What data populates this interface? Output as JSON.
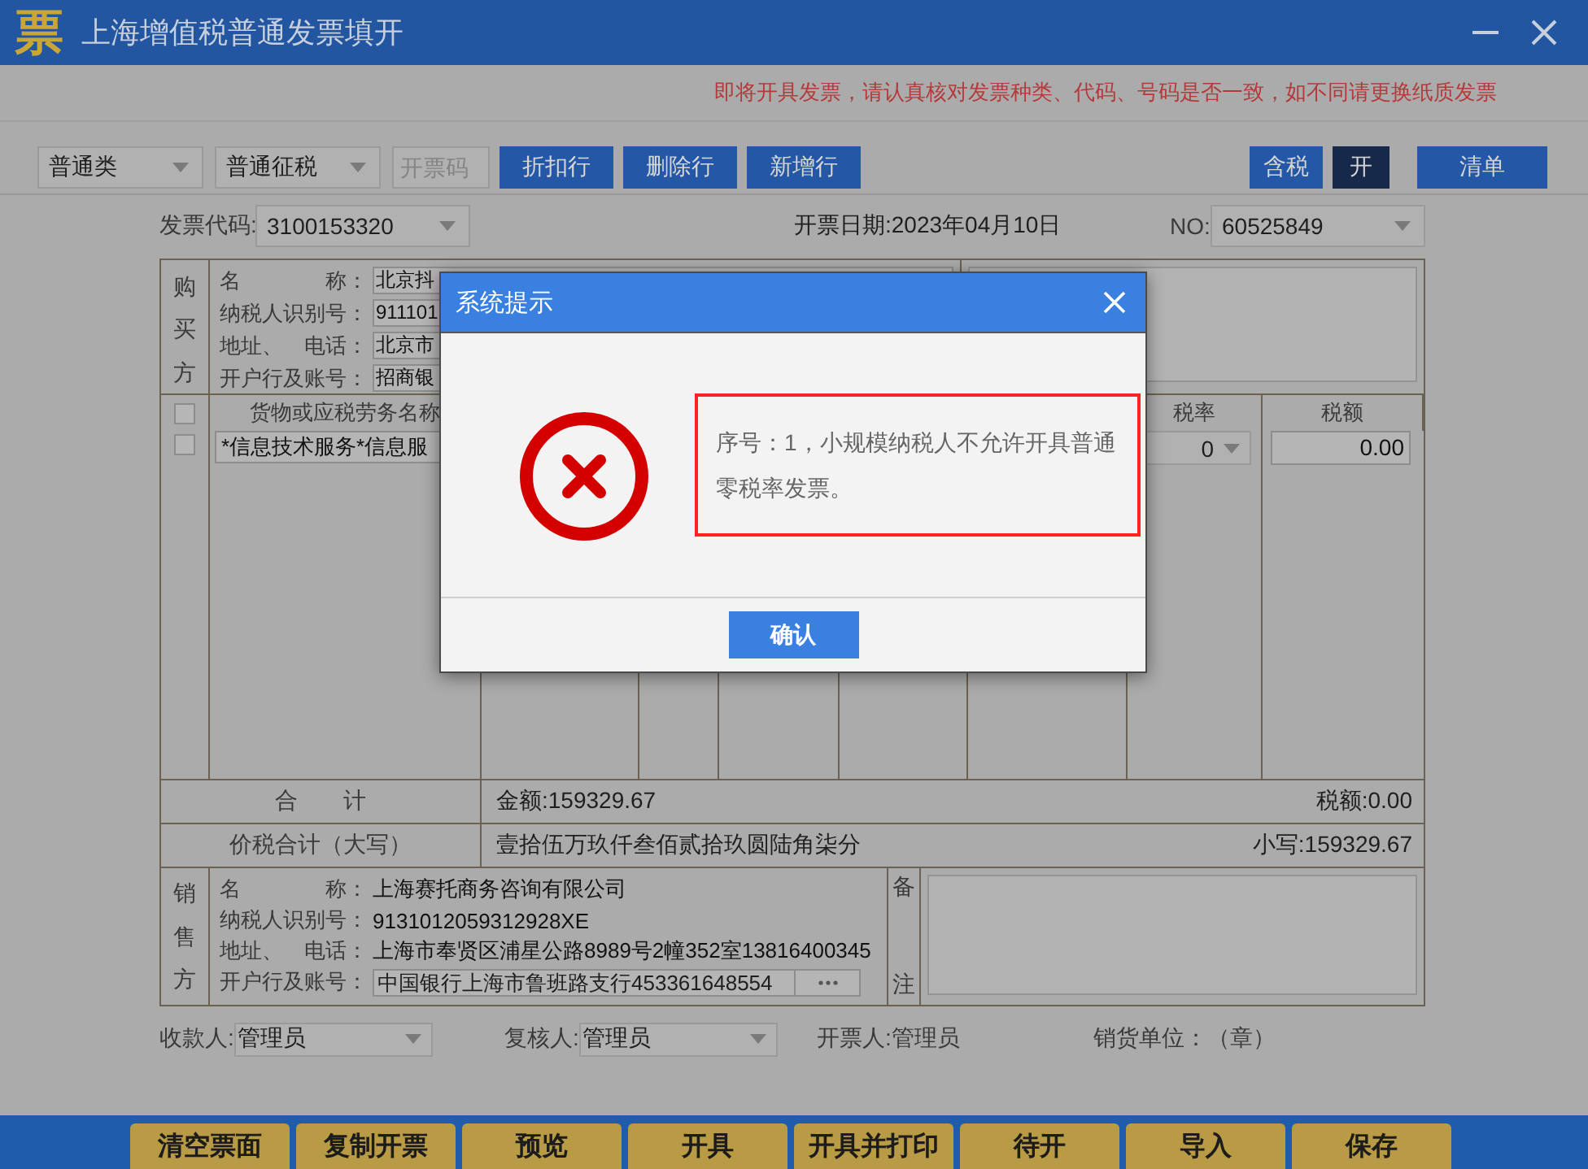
{
  "window": {
    "logo": "票",
    "title": "上海增值税普通发票填开"
  },
  "notice": "即将开具发票，请认真核对发票种类、代码、号码是否一致，如不同请更换纸质发票",
  "toolbar": {
    "selects": [
      {
        "value": "普通类"
      },
      {
        "value": "普通征税"
      }
    ],
    "code_field": {
      "placeholder": "开票码"
    },
    "buttons": [
      "折扣行",
      "删除行",
      "新增行"
    ],
    "tax_toggle": [
      {
        "label": "含税",
        "selected": false
      },
      {
        "label": "开",
        "selected": true
      }
    ],
    "list_button": "清单"
  },
  "header": {
    "code_label": "发票代码:",
    "code": "3100153320",
    "date": "开票日期:2023年04月10日",
    "no_label": "NO:",
    "no": "60525849"
  },
  "buyer": {
    "side_label": "购买方",
    "fields": [
      {
        "label": "名　　　　称：",
        "value": "北京抖"
      },
      {
        "label": "纳税人识别号：",
        "value": "911101"
      },
      {
        "label": "地址、　电话：",
        "value": "北京市"
      },
      {
        "label": "开户行及账号：",
        "value": "招商银"
      }
    ]
  },
  "items": {
    "select_all": {
      "checked": false
    },
    "columns": [
      {
        "label": "货物或应税劳务名称"
      },
      {
        "label": "税率"
      },
      {
        "label": "税额"
      }
    ],
    "rows": [
      {
        "checked": false,
        "name": "*信息技术服务*信息服",
        "tax_rate": "0",
        "tax": "0.00"
      }
    ]
  },
  "totals": {
    "label": "合　　计",
    "amount": "金额:159329.67",
    "tax": "税额:0.00"
  },
  "grand_total": {
    "label": "价税合计（大写）",
    "words": "壹拾伍万玖仟叁佰贰拾玖圆陆角柒分",
    "figure": "小写:159329.67"
  },
  "seller": {
    "side_label": "销售方",
    "fields": [
      {
        "label": "名　　　　称：",
        "value": "上海赛托商务咨询有限公司",
        "kind": "text"
      },
      {
        "label": "纳税人识别号：",
        "value": "9131012059312928XE",
        "kind": "text"
      },
      {
        "label": "地址、　电话：",
        "value": "上海市奉贤区浦星公路8989号2幢352室13816400345",
        "kind": "text"
      },
      {
        "label": "开户行及账号：",
        "value": "中国银行上海市鲁班路支行453361648554",
        "kind": "field"
      }
    ],
    "remark_label": [
      "备",
      "注"
    ]
  },
  "signers": [
    {
      "label": "收款人:",
      "value": "管理员",
      "kind": "select"
    },
    {
      "label": "复核人:",
      "value": "管理员",
      "kind": "select"
    },
    {
      "label": "开票人:管理员",
      "kind": "text"
    },
    {
      "label": "销货单位：（章）",
      "kind": "text"
    }
  ],
  "actions": [
    "清空票面",
    "复制开票",
    "预览",
    "开具",
    "开具并打印",
    "待开",
    "导入",
    "保存"
  ],
  "dialog": {
    "title": "系统提示",
    "message": "序号：1，小规模纳税人不允许开具普通零税率发票。",
    "button": "确认"
  }
}
